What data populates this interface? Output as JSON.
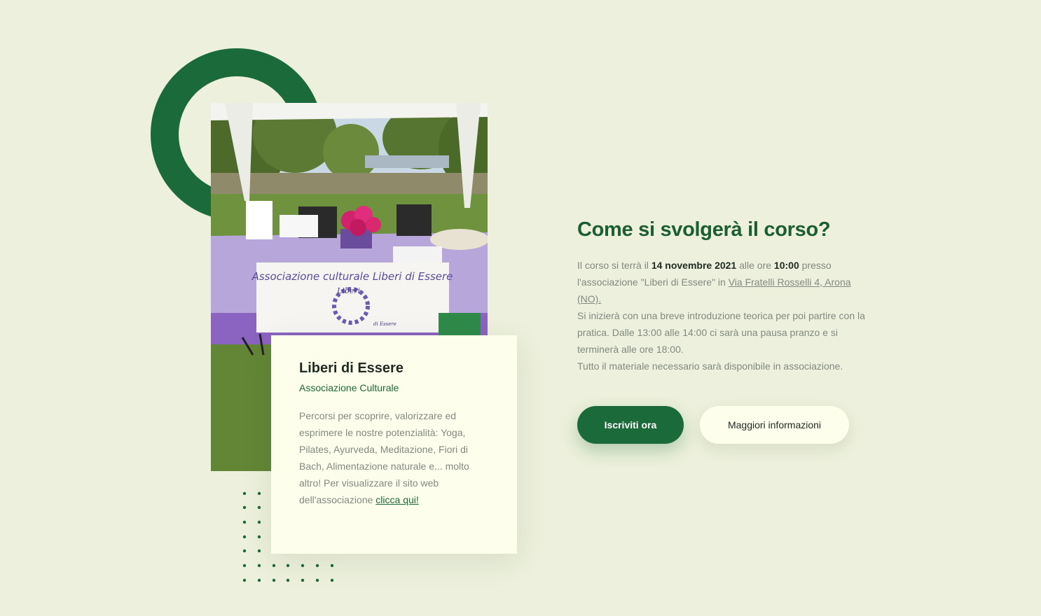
{
  "colors": {
    "background": "#ecf0dc",
    "brand_green": "#1b6a3a",
    "card_background": "#fdfeec",
    "body_text": "#828a80"
  },
  "association_card": {
    "title": "Liberi di Essere",
    "subtitle": "Associazione Culturale",
    "description": "Percorsi per scoprire, valorizzare ed esprimere le nostre potenzialità: Yoga, Pilates, Ayurveda, Meditazione, Fiori di Bach, Alimentazione naturale e... molto altro! Per visualizzare il sito web dell'associazione ",
    "link_label": "clicca qui!"
  },
  "photo": {
    "banner_text": "Associazione culturale Liberi di Essere",
    "logo_text_top": "Liberi",
    "logo_text_bottom": "di Essere"
  },
  "course_info": {
    "title": "Come si svolgerà il corso?",
    "p1_prefix": "Il corso si terrà il ",
    "date": "14 novembre 2021",
    "p1_mid": " alle ore ",
    "time": "10:00",
    "p1_suffix": " presso l'associazione \"Liberi di Essere\" in ",
    "address_link": "Via Fratelli Rosselli 4, Arona (NO).",
    "p2": "Si inizierà con una breve introduzione teorica per poi partire con la pratica. Dalle 13:00 alle 14:00 ci sarà una pausa pranzo e si terminerà alle ore 18:00.",
    "p3": "Tutto il materiale necessario sarà disponibile in associazione."
  },
  "buttons": {
    "primary_label": "Iscriviti ora",
    "secondary_label": "Maggiori informazioni"
  }
}
